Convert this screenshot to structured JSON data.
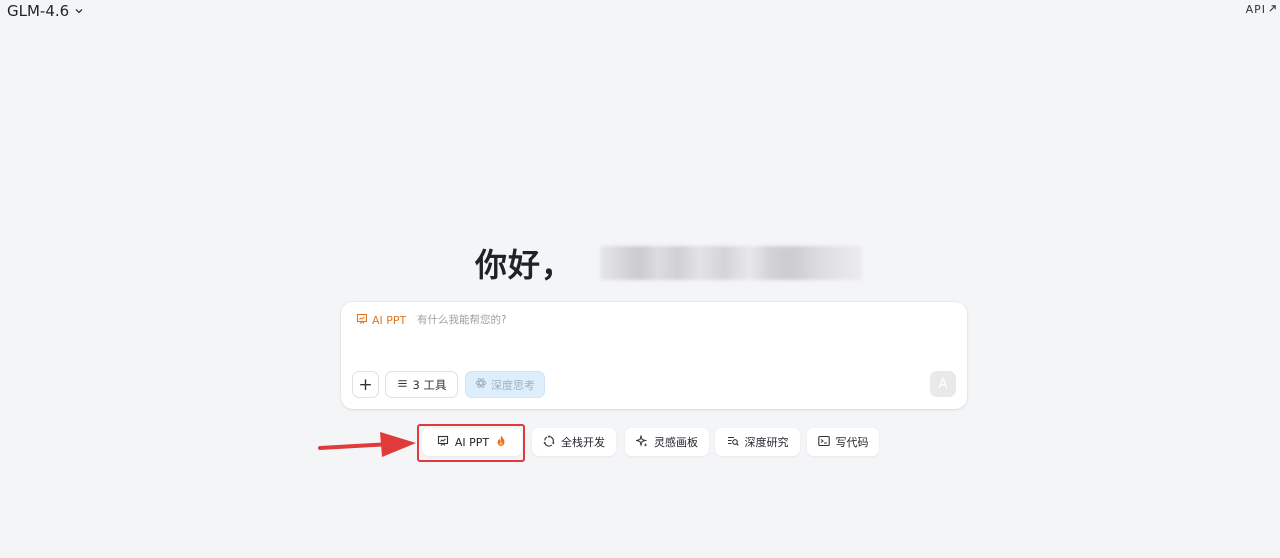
{
  "header": {
    "model_name": "GLM-4.6",
    "api_label": "API"
  },
  "greeting": {
    "text": "你好，"
  },
  "composer": {
    "mode_tag": "AI PPT",
    "placeholder": "有什么我能帮您的?",
    "plus_label": "+",
    "tools_label": "3 工具",
    "deep_think_label": "深度思考",
    "send_label": "A"
  },
  "quick_actions": {
    "ai_ppt": "AI PPT",
    "fullstack": "全栈开发",
    "inspiration": "灵感画板",
    "deep_research": "深度研究",
    "write_code": "写代码"
  },
  "colors": {
    "background": "#f4f5f7",
    "accent_orange": "#e3761f",
    "highlight_red": "#e03a3a",
    "deep_think_bg": "#dfeefb"
  }
}
